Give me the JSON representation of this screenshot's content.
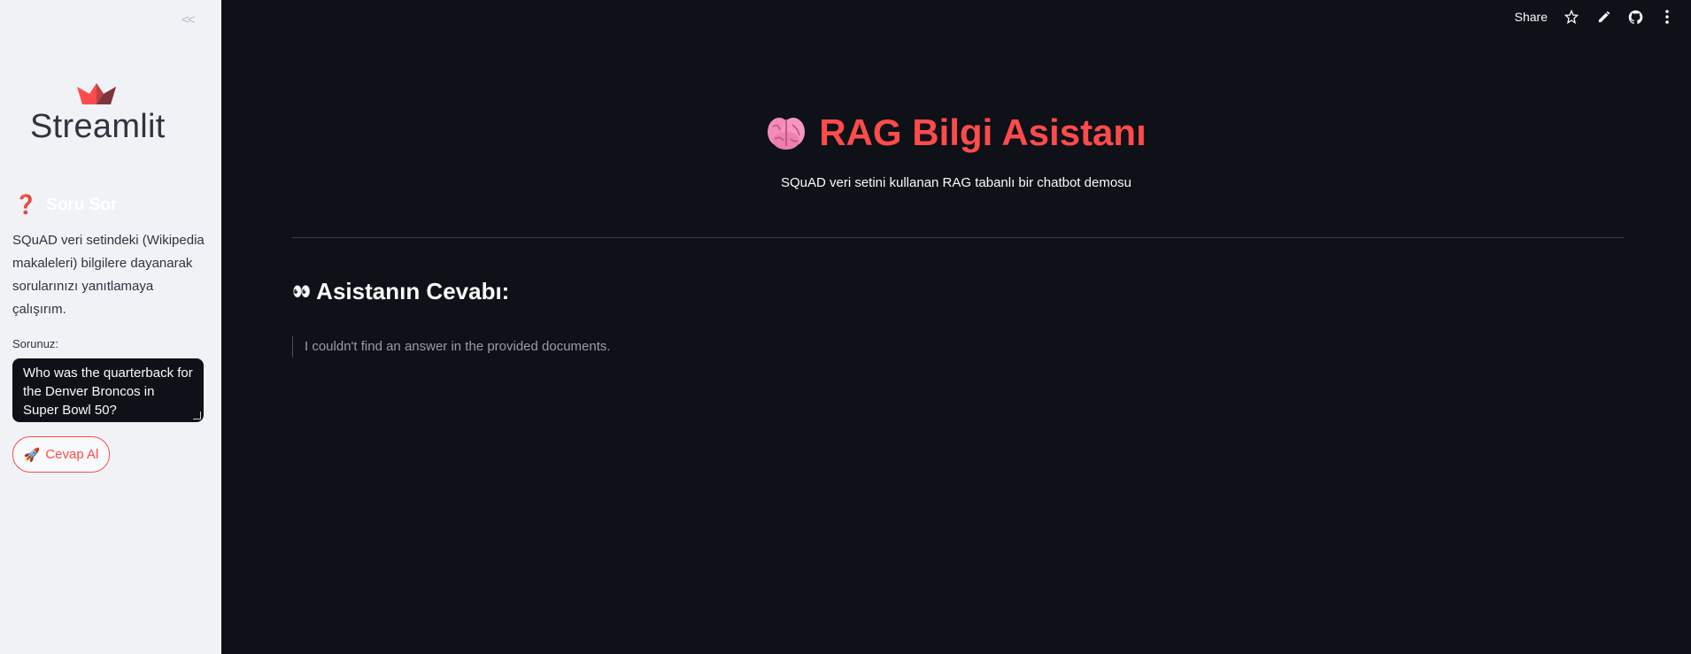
{
  "sidebar": {
    "collapse_label": "<<",
    "logo_text": "Streamlit",
    "header_icon": "❓",
    "header": "Soru Sor",
    "description": "SQuAD veri setindeki (Wikipedia makaleleri) bilgilere dayanarak sorularınızı yanıtlamaya çalışırım.",
    "input_label": "Sorunuz:",
    "question_value": "Who was the quarterback for the Denver Broncos in Super Bowl 50?",
    "submit_icon": "🚀",
    "submit_label": "Cevap Al"
  },
  "toolbar": {
    "share_label": "Share",
    "icons": [
      "star-icon",
      "edit-icon",
      "github-icon",
      "more-icon"
    ]
  },
  "main": {
    "title": "RAG Bilgi Asistanı",
    "subtitle": "SQuAD veri setini kullanan RAG tabanlı bir chatbot demosu",
    "answer_icon": "👀",
    "answer_heading": "Asistanın Cevabı:",
    "answer_text": "I couldn't find an answer in the provided documents."
  },
  "colors": {
    "accent": "#ff4b4b",
    "sidebar_bg": "#f0f2f6",
    "main_bg": "#0e1117"
  }
}
